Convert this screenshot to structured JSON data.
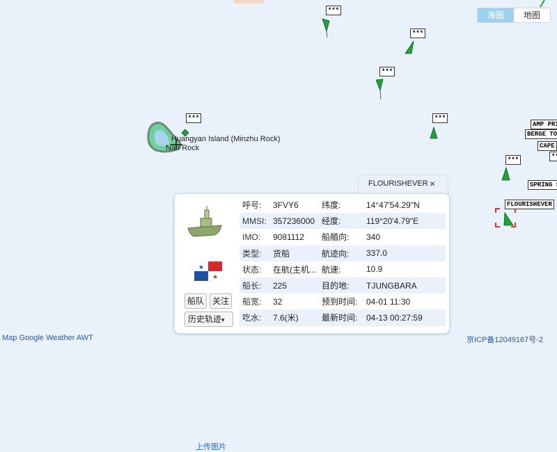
{
  "map_tabs": [
    {
      "label": "海图",
      "active": true
    },
    {
      "label": "地图",
      "active": false
    }
  ],
  "ship_labels": [
    "***",
    "***",
    "***",
    "***",
    "***",
    "***",
    "AMP PRI",
    "BERGE TOW",
    "CAPE",
    "***",
    "SPRING S",
    "FLOURISHEVER"
  ],
  "island": {
    "name": "Huangyan Island (Minzhu Rock)",
    "sub": "Nan Rock"
  },
  "popup": {
    "title": "FLOURISHEVER",
    "close": "×",
    "upload": "上传图片",
    "btn_fleet": "船队",
    "btn_follow": "关注",
    "btn_history": "历史轨迹",
    "rows": [
      {
        "k1": "呼号:",
        "v1": "3FVY6",
        "k2": "纬度:",
        "v2": "14°47'54.29\"N"
      },
      {
        "k1": "MMSI:",
        "v1": "357236000",
        "k2": "经度:",
        "v2": "119°20'4.79\"E"
      },
      {
        "k1": "IMO:",
        "v1": "9081112",
        "k2": "船艏向:",
        "v2": "340"
      },
      {
        "k1": "类型:",
        "v1": "货船",
        "k2": "航迹向:",
        "v2": "337.0"
      },
      {
        "k1": "状态:",
        "v1": "在航(主机...",
        "k2": "航速:",
        "v2": "10.9"
      },
      {
        "k1": "船长:",
        "v1": "225",
        "k2": "目的地:",
        "v2": "TJUNGBARA"
      },
      {
        "k1": "船宽:",
        "v1": "32",
        "k2": "预到时间:",
        "v2": "04-01 11:30"
      },
      {
        "k1": "吃水:",
        "v1": "7.6(米)",
        "k2": "最新时间:",
        "v2": "04-13 00:27:59"
      }
    ]
  },
  "footer": {
    "left": "Map Google Weather AWT",
    "right": "京ICP备12049167号-2"
  }
}
